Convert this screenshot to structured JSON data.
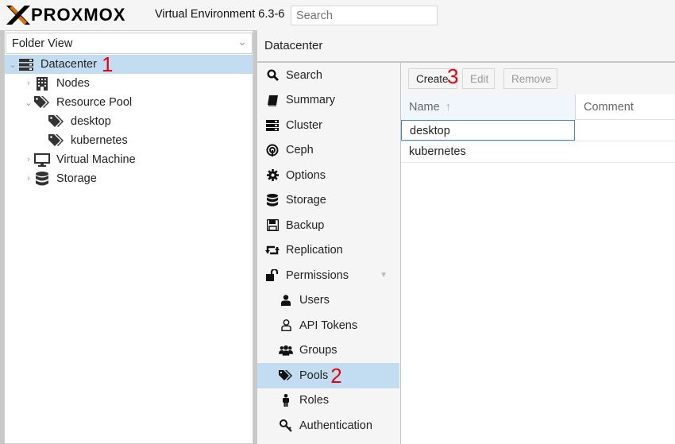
{
  "topbar": {
    "logo_text": "PROXMOX",
    "version": "Virtual Environment 6.3-6",
    "search_placeholder": "Search"
  },
  "left_panel": {
    "view_select": "Folder View",
    "tree": [
      {
        "label": "Datacenter",
        "marker": "1",
        "icon": "server-rack-icon",
        "selected": true
      },
      {
        "label": "Nodes",
        "icon": "building-icon"
      },
      {
        "label": "Resource Pool",
        "icon": "tags-icon"
      },
      {
        "label": "desktop",
        "icon": "tags-icon"
      },
      {
        "label": "kubernetes",
        "icon": "tags-icon"
      },
      {
        "label": "Virtual Machine",
        "icon": "monitor-icon"
      },
      {
        "label": "Storage",
        "icon": "database-icon"
      }
    ]
  },
  "content": {
    "header": "Datacenter",
    "nav": [
      {
        "label": "Search",
        "icon": "search-icon"
      },
      {
        "label": "Summary",
        "icon": "book-icon"
      },
      {
        "label": "Cluster",
        "icon": "server-icon"
      },
      {
        "label": "Ceph",
        "icon": "ceph-icon"
      },
      {
        "label": "Options",
        "icon": "gear-icon"
      },
      {
        "label": "Storage",
        "icon": "database-icon"
      },
      {
        "label": "Backup",
        "icon": "floppy-icon"
      },
      {
        "label": "Replication",
        "icon": "retweet-icon"
      },
      {
        "label": "Permissions",
        "icon": "unlock-icon"
      },
      {
        "label": "Users",
        "icon": "user-icon"
      },
      {
        "label": "API Tokens",
        "icon": "user-outline-icon"
      },
      {
        "label": "Groups",
        "icon": "users-icon"
      },
      {
        "label": "Pools",
        "icon": "tags-icon",
        "marker": "2",
        "selected": true
      },
      {
        "label": "Roles",
        "icon": "male-icon"
      },
      {
        "label": "Authentication",
        "icon": "key-icon"
      }
    ],
    "toolbar": {
      "create": "Create",
      "create_marker": "3",
      "edit": "Edit",
      "remove": "Remove"
    },
    "grid": {
      "col_name": "Name",
      "col_comment": "Comment",
      "rows": [
        "desktop",
        "kubernetes"
      ]
    }
  }
}
